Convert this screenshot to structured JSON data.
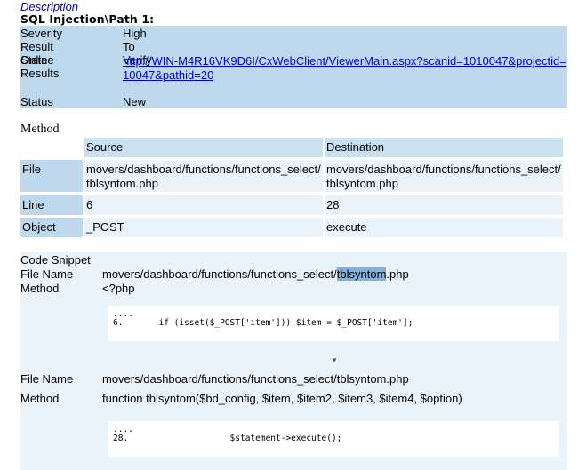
{
  "description_link": "Description",
  "path_title": "SQL Injection\\Path 1:",
  "info": {
    "severity_label": "Severity",
    "severity_value": "High",
    "result_state_label": "Result State",
    "result_state_value": "To Verify",
    "online_results_label": "Online Results",
    "online_results_url": "http://WIN-M4R16VK9D6I/CxWebClient/ViewerMain.aspx?scanid=1010047&projectid=10047&pathid=20",
    "status_label": "Status",
    "status_value": "New"
  },
  "method_title": "Method",
  "table": {
    "headers": {
      "source": "Source",
      "destination": "Destination"
    },
    "rows": [
      {
        "label": "File",
        "source": "movers/dashboard/functions/functions_select/tblsyntom.php",
        "destination": "movers/dashboard/functions/functions_select/tblsyntom.php"
      },
      {
        "label": "Line",
        "source": "6",
        "destination": "28"
      },
      {
        "label": "Object",
        "source": "_POST",
        "destination": "execute"
      }
    ]
  },
  "snippet": {
    "title": "Code Snippet",
    "blocks": [
      {
        "file_label": "File Name",
        "file_prefix": "movers/dashboard/functions/functions_select/",
        "file_highlight": "tblsyntom",
        "file_suffix": ".php",
        "method_label": "Method",
        "method_value": "<?php",
        "code_dots": "....",
        "code_line": "6.       if (isset($_POST['item'])) $item = $_POST['item'];"
      },
      {
        "file_label": "File Name",
        "file_value": "movers/dashboard/functions/functions_select/tblsyntom.php",
        "method_label": "Method",
        "method_value": "function tblsyntom($bd_config, $item, $item2, $item3, $item4, $option)",
        "code_dots": "....",
        "code_line": "28.                    $statement->execute();"
      }
    ],
    "arrow_glyph": "▼"
  }
}
